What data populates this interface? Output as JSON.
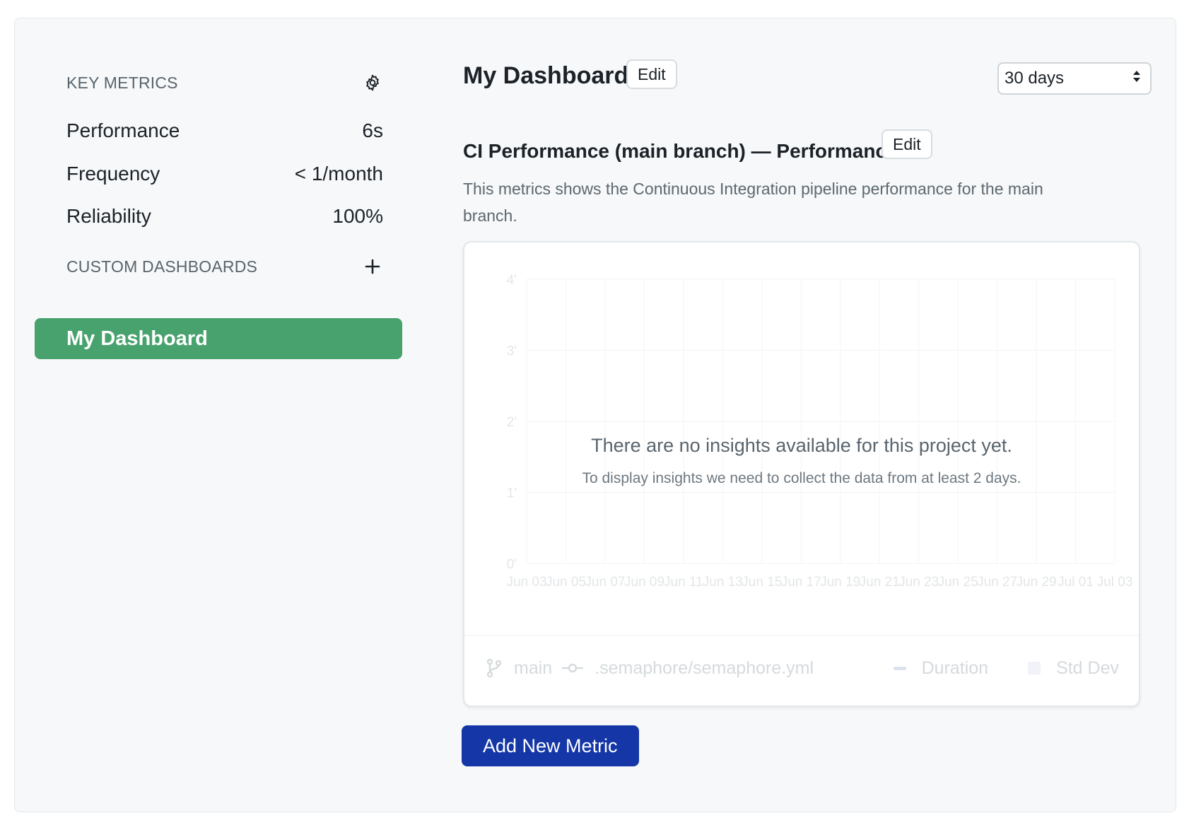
{
  "sidebar": {
    "key_metrics_heading": "KEY METRICS",
    "metrics": [
      {
        "label": "Performance",
        "value": "6s"
      },
      {
        "label": "Frequency",
        "value": "< 1/month"
      },
      {
        "label": "Reliability",
        "value": "100%"
      }
    ],
    "custom_dashboards_heading": "CUSTOM DASHBOARDS",
    "dashboards": [
      {
        "label": "My Dashboard",
        "active": true
      }
    ]
  },
  "main": {
    "title": "My Dashboard",
    "edit_label": "Edit",
    "range_select": {
      "value": "30 days"
    },
    "metric": {
      "title": "CI Performance (main branch) — Performance",
      "edit_label": "Edit",
      "description": "This metrics shows the Continuous Integration pipeline performance for the main branch."
    },
    "chart": {
      "empty_title": "There are no insights available for this project yet.",
      "empty_subtitle": "To display insights we need to collect the data from at least 2 days.",
      "branch": "main",
      "pipeline_file": ".semaphore/semaphore.yml",
      "legend": [
        "Duration",
        "Std Dev"
      ]
    },
    "add_metric_label": "Add New Metric"
  },
  "colors": {
    "accent_green": "#48a26e",
    "primary_blue": "#1436a6",
    "panel_bg": "#f6f8f9"
  },
  "chart_data": {
    "type": "line",
    "y_ticks": [
      "0'",
      "1'",
      "2'",
      "3'",
      "4'"
    ],
    "ylim": [
      0,
      4
    ],
    "x_ticks": [
      "Jun 03",
      "Jun 05",
      "Jun 07",
      "Jun 09",
      "Jun 11",
      "Jun 13",
      "Jun 15",
      "Jun 17",
      "Jun 19",
      "Jun 21",
      "Jun 23",
      "Jun 25",
      "Jun 27",
      "Jun 29",
      "Jul 01",
      "Jul 03"
    ],
    "series": [
      {
        "name": "Duration",
        "values": []
      },
      {
        "name": "Std Dev",
        "values": []
      }
    ],
    "grid": true
  }
}
